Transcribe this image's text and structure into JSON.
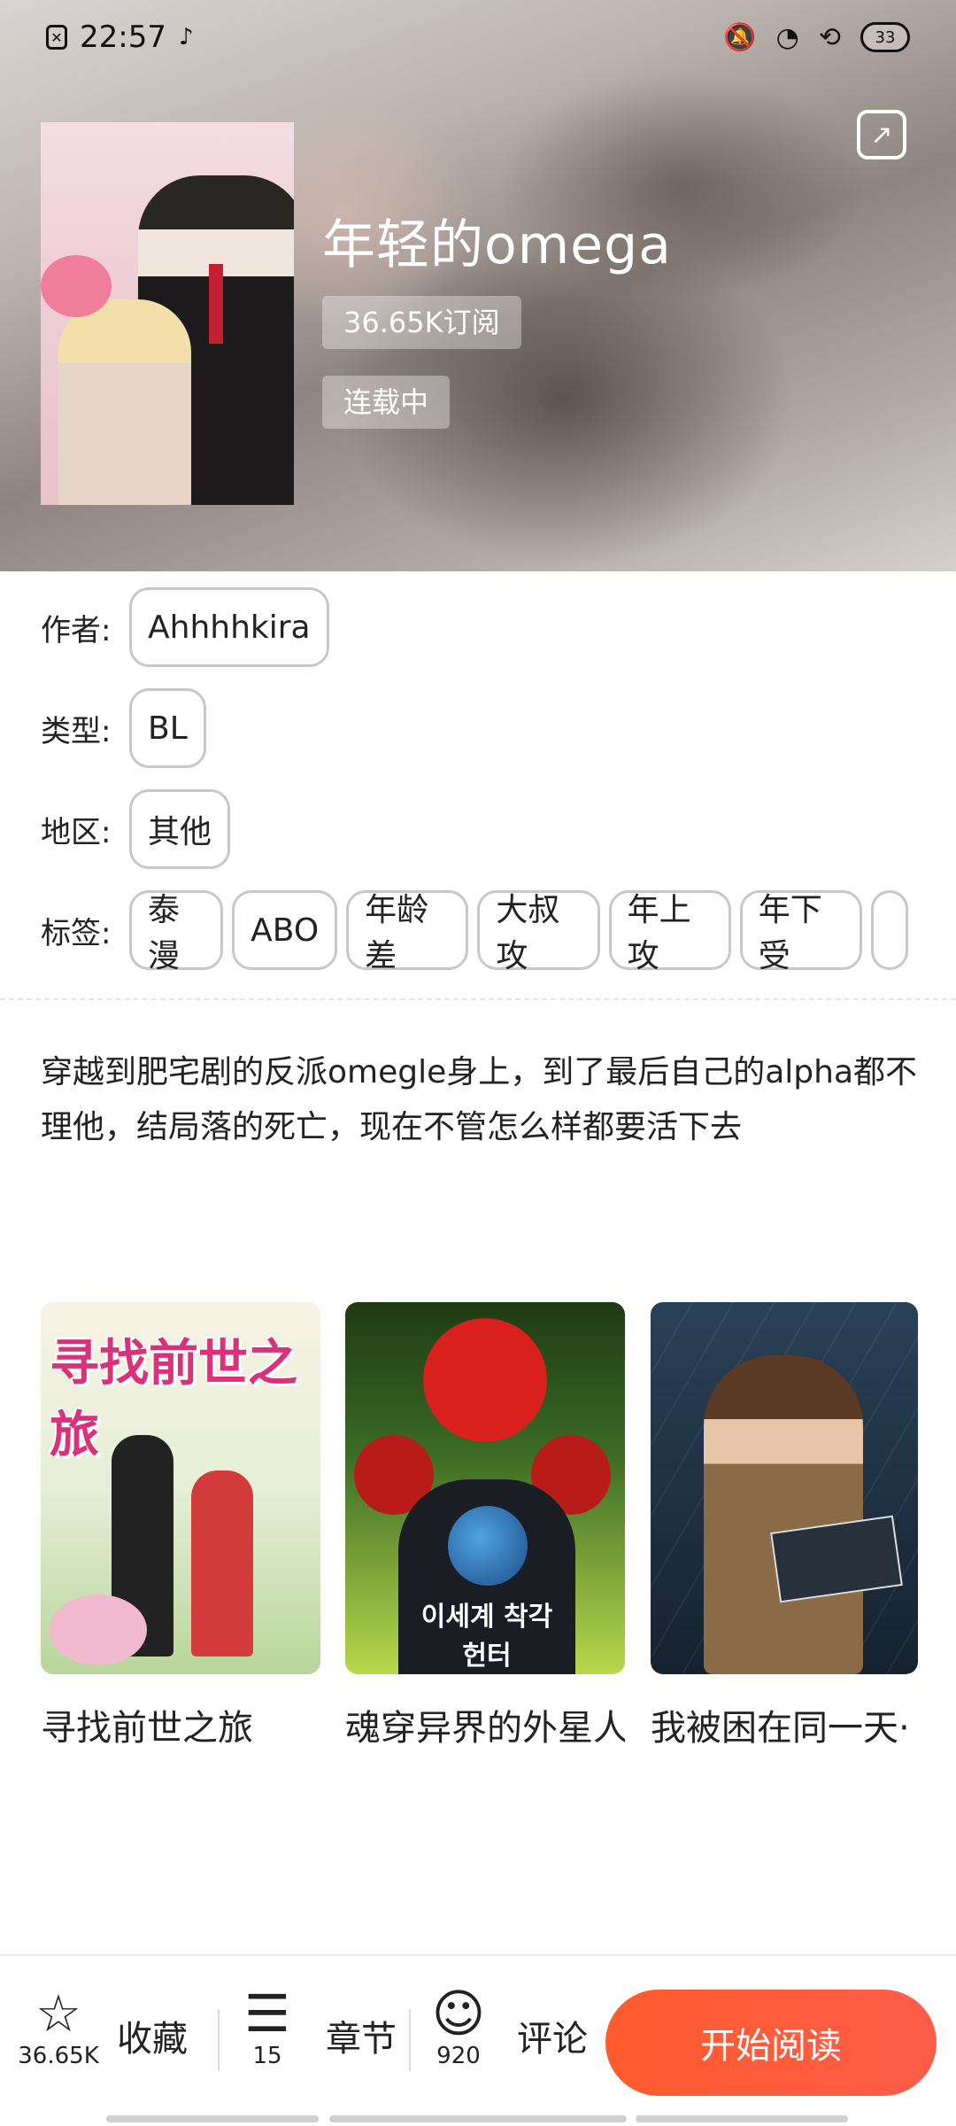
{
  "status_bar": {
    "time": "22:57",
    "battery": "33"
  },
  "header": {
    "title": "年轻的omega",
    "subscriptions": "36.65K订阅",
    "status": "连载中"
  },
  "info": {
    "author_label": "作者:",
    "author": "Ahhhhkira",
    "type_label": "类型:",
    "type": "BL",
    "region_label": "地区:",
    "region": "其他",
    "tags_label": "标签:",
    "tags": [
      "泰漫",
      "ABO",
      "年龄差",
      "大叔攻",
      "年上攻",
      "年下受"
    ]
  },
  "description": "穿越到肥宅剧的反派omegle身上，到了最后自己的alpha都不理他，结局落的死亡，现在不管怎么样都要活下去",
  "recommendations": [
    {
      "name": "寻找前世之旅",
      "cover_text": "寻找前世之旅"
    },
    {
      "name": "魂穿异界的外星人",
      "cover_text": "이세계 착각 헌터"
    },
    {
      "name": "我被困在同一天·"
    }
  ],
  "bottom_bar": {
    "favorite_count": "36.65K",
    "favorite_label": "收藏",
    "chapter_count": "15",
    "chapter_label": "章节",
    "comment_count": "920",
    "comment_label": "评论",
    "read_button": "开始阅读"
  },
  "colors": {
    "accent": "#ff5b2e",
    "tag_border": "#c8c8c8"
  }
}
